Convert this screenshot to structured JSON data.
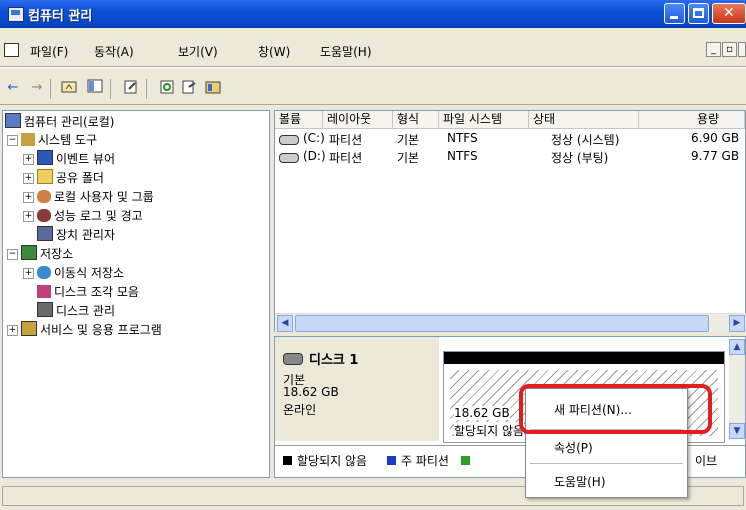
{
  "window": {
    "title": "컴퓨터 관리"
  },
  "menu": {
    "items": [
      "파일(F)",
      "동작(A)",
      "보기(V)",
      "창(W)",
      "도움말(H)"
    ]
  },
  "tree": {
    "root": "컴퓨터 관리(로컬)",
    "system_tools": "시스템 도구",
    "event_viewer": "이벤트 뷰어",
    "shared_folders": "공유 폴더",
    "local_users": "로컬 사용자 및 그룹",
    "perf_logs": "성능 로그 및 경고",
    "device_manager": "장치 관리자",
    "storage": "저장소",
    "removable": "이동식 저장소",
    "defrag": "디스크 조각 모음",
    "disk_mgmt": "디스크 관리",
    "services_apps": "서비스 및 응용 프로그램"
  },
  "volumes": {
    "headers": [
      "볼륨",
      "레이아웃",
      "형식",
      "파일 시스템",
      "상태",
      "용량"
    ],
    "rows": [
      [
        "(C:)",
        "파티션",
        "기본",
        "NTFS",
        "정상 (시스템)",
        "6.90 GB"
      ],
      [
        "(D:)",
        "파티션",
        "기본",
        "NTFS",
        "정상 (부팅)",
        "9.77 GB"
      ]
    ]
  },
  "disk": {
    "name": "디스크 1",
    "type": "기본",
    "size": "18.62 GB",
    "status": "온라인",
    "partition_size": "18.62 GB",
    "partition_status": "할당되지 않음"
  },
  "legend": {
    "unallocated": "할당되지 않음",
    "primary": "주 파티션",
    "dynamic_tail": "이브"
  },
  "context_menu": {
    "new_partition": "새 파티션(N)...",
    "properties": "속성(P)",
    "help": "도움말(H)"
  },
  "colors": {
    "highlight": "#e02020",
    "legend_unallocated": "#000000",
    "legend_primary": "#1a3cc8",
    "legend_extended": "#2aa02a"
  }
}
